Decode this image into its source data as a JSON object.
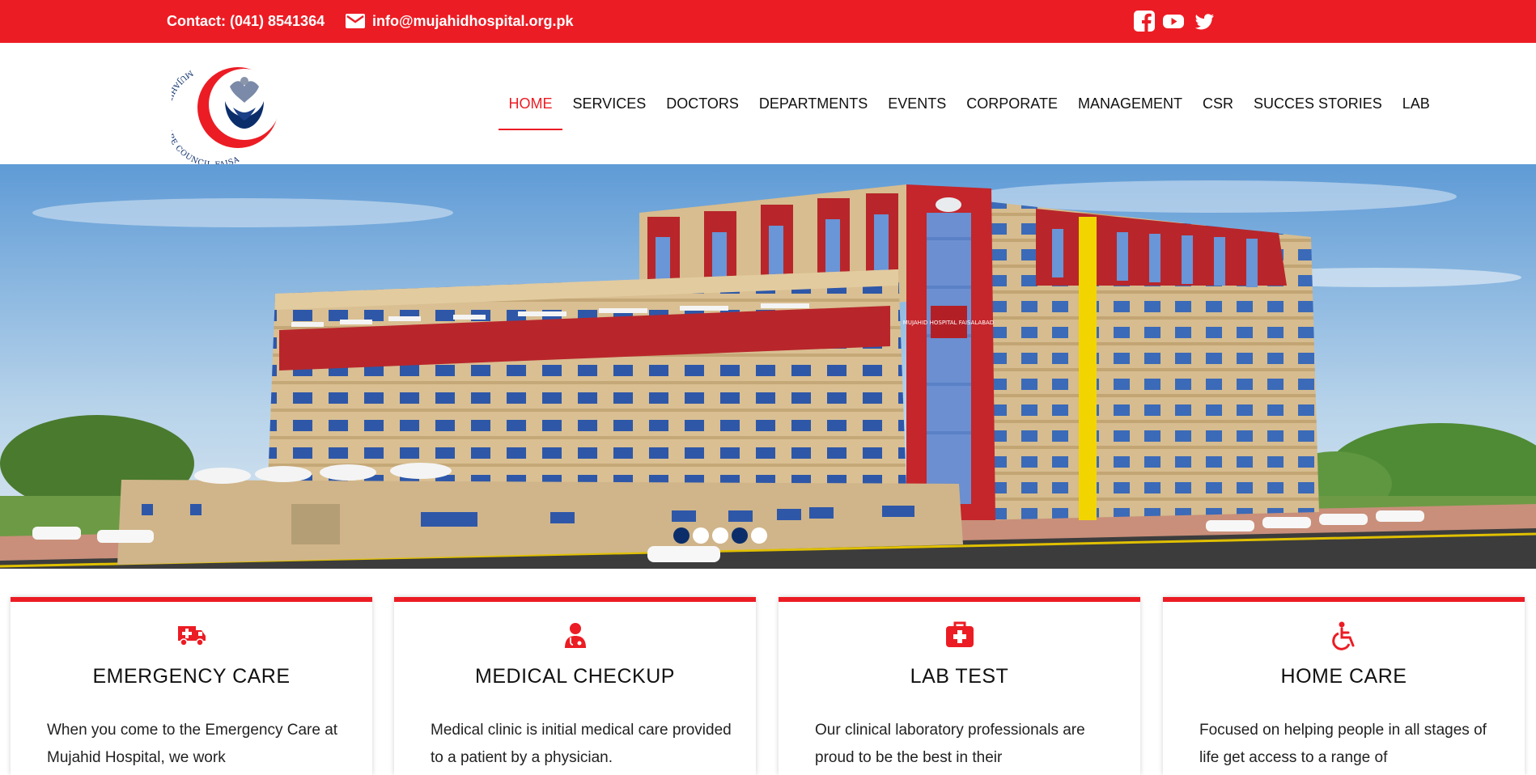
{
  "topbar": {
    "contact": "Contact: (041) 8541364",
    "email": "info@mujahidhospital.org.pk",
    "mail_icon": "mail-icon",
    "social": [
      "facebook-icon",
      "youtube-icon",
      "twitter-icon"
    ]
  },
  "logo": {
    "text": "MUJAHID WELFARE COUNCIL FAISALABAD"
  },
  "nav": {
    "items": [
      {
        "label": "HOME",
        "active": true
      },
      {
        "label": "SERVICES"
      },
      {
        "label": "DOCTORS"
      },
      {
        "label": "DEPARTMENTS"
      },
      {
        "label": "EVENTS"
      },
      {
        "label": "CORPORATE"
      },
      {
        "label": "MANAGEMENT"
      },
      {
        "label": "CSR"
      },
      {
        "label": "SUCCES STORIES"
      },
      {
        "label": "LAB"
      }
    ]
  },
  "hero": {
    "building_sign": "MUJAHID HOSPITAL FAISALABAD",
    "slides": 5,
    "dot_states": [
      "navy",
      "white",
      "white",
      "navy",
      "white"
    ]
  },
  "cards": [
    {
      "title": "EMERGENCY CARE",
      "icon": "ambulance-icon",
      "desc": "When you come to the Emergency Care at Mujahid Hospital, we work"
    },
    {
      "title": "MEDICAL CHECKUP",
      "icon": "doctor-icon",
      "desc": "Medical clinic is initial medical care provided to a patient by a physician."
    },
    {
      "title": "LAB TEST",
      "icon": "medical-kit-icon",
      "desc": "Our clinical laboratory professionals are proud to be the best in their"
    },
    {
      "title": "HOME CARE",
      "icon": "wheelchair-icon",
      "desc": "Focused on helping people in all stages of life get access to a range of"
    }
  ],
  "colors": {
    "brand_red": "#ec1c24",
    "navy": "#0b2e6b"
  }
}
